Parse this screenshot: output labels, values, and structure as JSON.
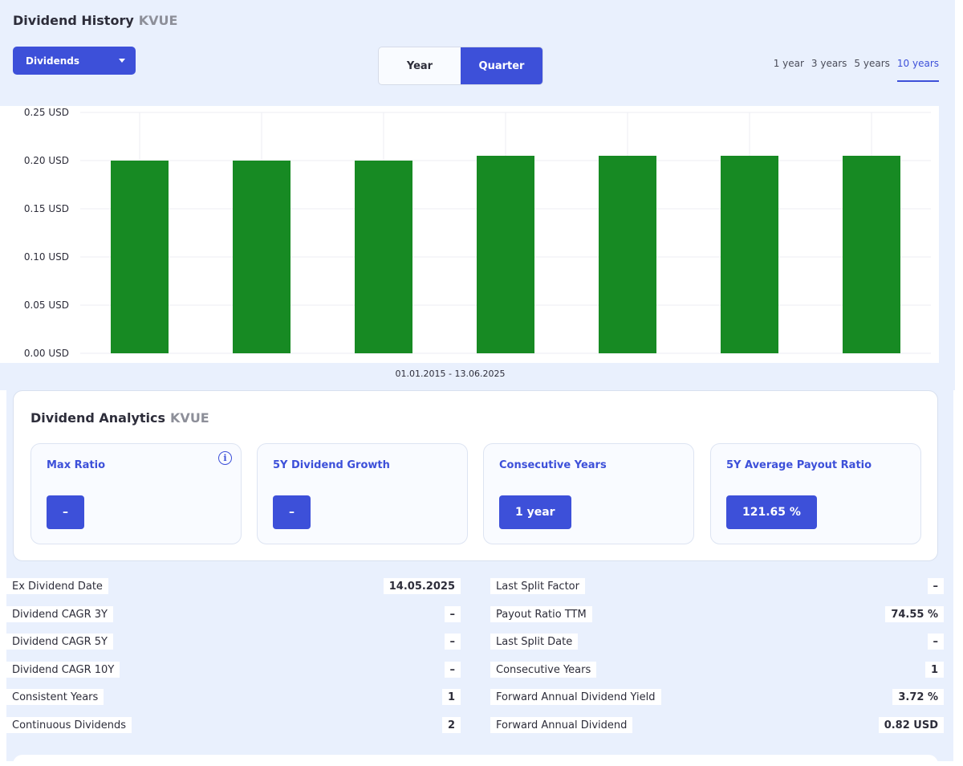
{
  "header": {
    "title": "Dividend History",
    "ticker": "KVUE"
  },
  "dropdown": {
    "label": "Dividends"
  },
  "period_toggle": {
    "options": [
      "Year",
      "Quarter"
    ],
    "selected": "Quarter"
  },
  "range_tabs": {
    "options": [
      "1 year",
      "3 years",
      "5 years",
      "10 years"
    ],
    "selected": "10 years"
  },
  "colors": {
    "accent": "#3d50d9",
    "bar": "#178a23",
    "background": "#e9f0fd"
  },
  "chart_data": {
    "type": "bar",
    "categories": [
      "",
      "",
      "",
      "",
      "",
      "",
      ""
    ],
    "values": [
      0.2,
      0.2,
      0.2,
      0.205,
      0.205,
      0.205,
      0.205
    ],
    "ylim": [
      0,
      0.25
    ],
    "yticks": [
      "0.00 USD",
      "0.05 USD",
      "0.10 USD",
      "0.15 USD",
      "0.20 USD",
      "0.25 USD"
    ],
    "grid": true,
    "xlabel": "01.01.2015 - 13.06.2025"
  },
  "analytics": {
    "title": "Dividend Analytics",
    "ticker": "KVUE",
    "cards": [
      {
        "label": "Max Ratio",
        "value": "–",
        "info": "i"
      },
      {
        "label": "5Y Dividend Growth",
        "value": "–"
      },
      {
        "label": "Consecutive Years",
        "value": "1 year"
      },
      {
        "label": "5Y Average Payout Ratio",
        "value": "121.65 %"
      }
    ]
  },
  "stats": {
    "left": [
      {
        "label": "Ex Dividend Date",
        "value": "14.05.2025"
      },
      {
        "label": "Dividend CAGR 3Y",
        "value": "–"
      },
      {
        "label": "Dividend CAGR 5Y",
        "value": "–"
      },
      {
        "label": "Dividend CAGR 10Y",
        "value": "–"
      },
      {
        "label": "Consistent Years",
        "value": "1"
      },
      {
        "label": "Continuous Dividends",
        "value": "2"
      }
    ],
    "right": [
      {
        "label": "Last Split Factor",
        "value": "–"
      },
      {
        "label": "Payout Ratio TTM",
        "value": "74.55 %"
      },
      {
        "label": "Last Split Date",
        "value": "–"
      },
      {
        "label": "Consecutive Years",
        "value": "1"
      },
      {
        "label": "Forward Annual Dividend Yield",
        "value": "3.72 %"
      },
      {
        "label": "Forward Annual Dividend",
        "value": "0.82 USD"
      }
    ]
  }
}
